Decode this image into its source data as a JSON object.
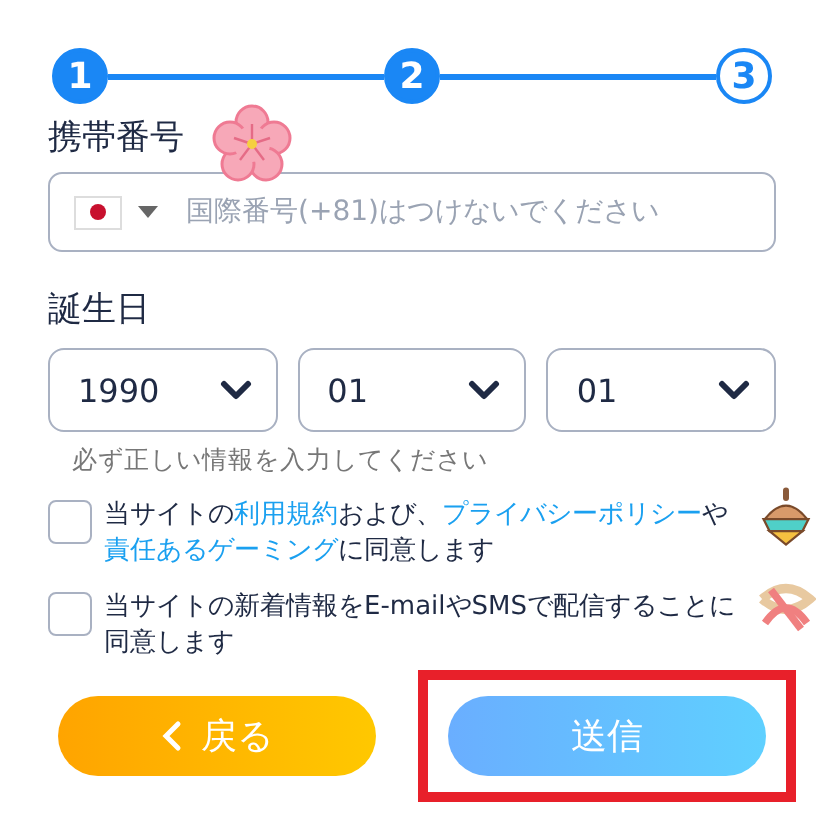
{
  "stepper": {
    "steps": [
      {
        "label": "1",
        "done": true
      },
      {
        "label": "2",
        "done": true
      },
      {
        "label": "3",
        "done": false
      }
    ]
  },
  "phone": {
    "label": "携帯番号",
    "placeholder": "国際番号(+81)はつけないでください"
  },
  "birthday": {
    "label": "誕生日",
    "selects": [
      {
        "value": "1990"
      },
      {
        "value": "01"
      },
      {
        "value": "01"
      }
    ],
    "hint": "必ず正しい情報を入力してください"
  },
  "agreements": [
    {
      "checked": false,
      "segments": [
        {
          "kind": "text",
          "text": "当サイトの"
        },
        {
          "kind": "link",
          "text": "利用規約"
        },
        {
          "kind": "text",
          "text": "および、"
        },
        {
          "kind": "link",
          "text": "プライバシーポリシー"
        },
        {
          "kind": "text",
          "text": "や"
        },
        {
          "kind": "link",
          "text": "責任あるゲーミング"
        },
        {
          "kind": "text",
          "text": "に同意します"
        }
      ]
    },
    {
      "checked": false,
      "segments": [
        {
          "kind": "text",
          "text": "当サイトの新着情報をE-mailやSMSで配信することに同意します"
        }
      ]
    }
  ],
  "buttons": [
    {
      "kind": "back",
      "label": "戻る",
      "highlighted": false
    },
    {
      "kind": "submit",
      "label": "送信",
      "highlighted": true
    }
  ]
}
